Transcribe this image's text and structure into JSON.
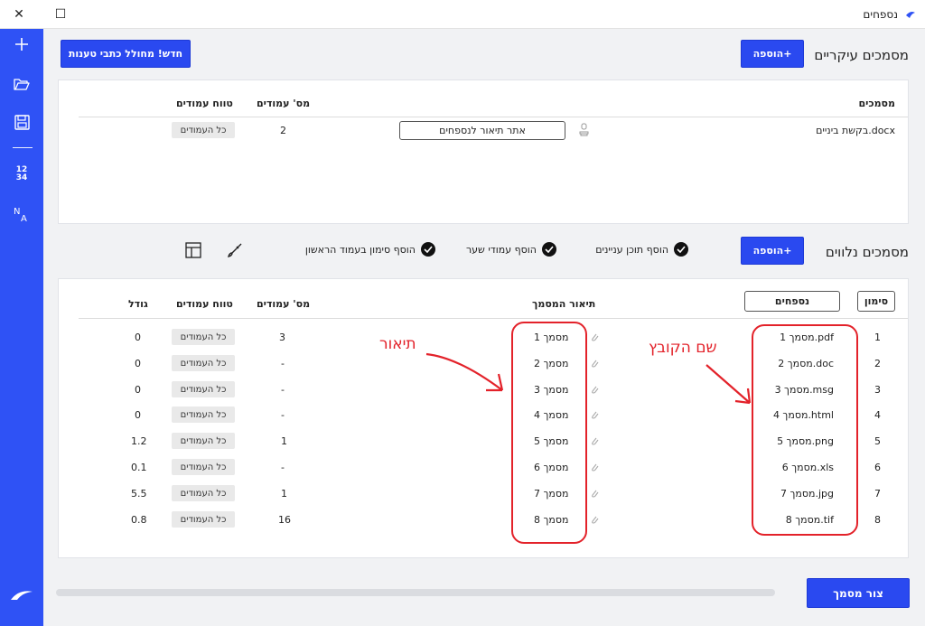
{
  "window": {
    "title": "נספחים",
    "close_glyph": "✕",
    "maximize_glyph": "☐"
  },
  "rail": {
    "numbers_icon_label": "12\n34"
  },
  "main_docs": {
    "title": "מסמכים עיקריים",
    "add_button": "הוספה+",
    "new_from_wizard_button": "חדש! מחולל כתבי טענות",
    "columns": {
      "documents": "מסמכים",
      "page_count": "מס' עמודים",
      "page_range": "טווח עמודים"
    },
    "rows": [
      {
        "name": "בקשת ביניים.docx",
        "description_button": "אתר תיאור לנספחים",
        "page_count": "2",
        "page_range": "כל העמודים"
      }
    ]
  },
  "attached_docs": {
    "title": "מסמכים נלווים",
    "add_button": "הוספה+",
    "options": [
      {
        "label": "הוסף תוכן עניינים",
        "checked": true
      },
      {
        "label": "הוסף עמודי שער",
        "checked": true
      },
      {
        "label": "הוסף סימון בעמוד הראשון",
        "checked": true
      }
    ],
    "columns": {
      "mark": "סימון",
      "appendices": "נספחים",
      "description": "תיאור המסמך",
      "page_count": "מס' עמודים",
      "page_range": "טווח עמודים",
      "size": "גודל"
    },
    "rows": [
      {
        "mark": "1",
        "file": "מסמך 1.pdf",
        "description": "מסמך 1",
        "page_count": "3",
        "page_range": "כל העמודים",
        "size": "0"
      },
      {
        "mark": "2",
        "file": "מסמך 2.doc",
        "description": "מסמך 2",
        "page_count": "-",
        "page_range": "כל העמודים",
        "size": "0"
      },
      {
        "mark": "3",
        "file": "מסמך 3.msg",
        "description": "מסמך 3",
        "page_count": "-",
        "page_range": "כל העמודים",
        "size": "0"
      },
      {
        "mark": "4",
        "file": "מסמך 4.html",
        "description": "מסמך 4",
        "page_count": "-",
        "page_range": "כל העמודים",
        "size": "0"
      },
      {
        "mark": "5",
        "file": "מסמך 5.png",
        "description": "מסמך 5",
        "page_count": "1",
        "page_range": "כל העמודים",
        "size": "1.2"
      },
      {
        "mark": "6",
        "file": "מסמך 6.xls",
        "description": "מסמך 6",
        "page_count": "-",
        "page_range": "כל העמודים",
        "size": "0.1"
      },
      {
        "mark": "7",
        "file": "מסמך 7.jpg",
        "description": "מסמך 7",
        "page_count": "1",
        "page_range": "כל העמודים",
        "size": "5.5"
      },
      {
        "mark": "8",
        "file": "מסמך 8.tif",
        "description": "מסמך 8",
        "page_count": "16",
        "page_range": "כל העמודים",
        "size": "0.8"
      }
    ]
  },
  "annotations": {
    "file_name_label": "שם הקובץ",
    "description_label": "תיאור",
    "color": "#e3222a"
  },
  "footer": {
    "create_document_button": "צור מסמך"
  },
  "colors": {
    "accent": "#2a49f0",
    "rail": "#2f52f5"
  }
}
